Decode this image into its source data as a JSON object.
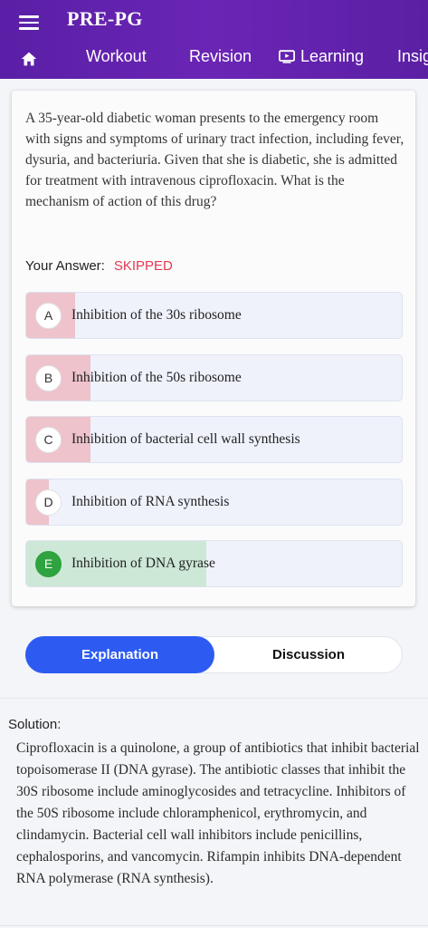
{
  "header": {
    "app_title": "PRE-PG",
    "menu_icon": "hamburger-menu-icon",
    "bg_color": "#5b1fa6",
    "nav": {
      "home_icon": "home-icon",
      "items": [
        {
          "label": "Workout"
        },
        {
          "label": "Revision"
        },
        {
          "label": "Learning",
          "icon": "play-screen-icon"
        },
        {
          "label": "Insig"
        }
      ]
    }
  },
  "question": {
    "text": "A 35-year-old diabetic woman presents to the emergency room with signs and symptoms of urinary tract infection, including fever, dysuria, and bacteriuria. Given that she is diabetic, she is admitted for treatment with intravenous ciprofloxacin. What is the mechanism of action of this drug?",
    "answer_label": "Your Answer:",
    "answer_status": "SKIPPED",
    "status_color": "#e53950"
  },
  "options": [
    {
      "letter": "A",
      "text": "Inhibition of the 30s ribosome",
      "percent": 13,
      "correct": false
    },
    {
      "letter": "B",
      "text": "Inhibition of the 50s ribosome",
      "percent": 17,
      "correct": false
    },
    {
      "letter": "C",
      "text": "Inhibition of bacterial cell wall synthesis",
      "percent": 17,
      "correct": false
    },
    {
      "letter": "D",
      "text": "Inhibition of RNA synthesis",
      "percent": 6,
      "correct": false
    },
    {
      "letter": "E",
      "text": "Inhibition of DNA gyrase",
      "percent": 48,
      "correct": true
    }
  ],
  "colors": {
    "wrong_fill": "#eec3cb",
    "correct_fill": "#cde8d6",
    "correct_badge": "#2ea33f",
    "active_tab": "#2d5bf2"
  },
  "tabs": {
    "explanation": "Explanation",
    "discussion": "Discussion",
    "active": "Explanation"
  },
  "solution": {
    "label": "Solution:",
    "text": "Ciprofloxacin is a quinolone, a group of antibiotics that inhibit bacterial topoisomerase II (DNA gyrase). The antibiotic classes that inhibit the 30S ribosome include aminoglycosides and tetracycline. Inhibitors of the 50S ribosome include chloramphenicol, erythromycin, and clindamycin. Bacterial cell wall inhibitors include penicillins, cephalosporins, and vancomycin. Rifampin inhibits DNA-dependent RNA polymerase (RNA synthesis)."
  }
}
